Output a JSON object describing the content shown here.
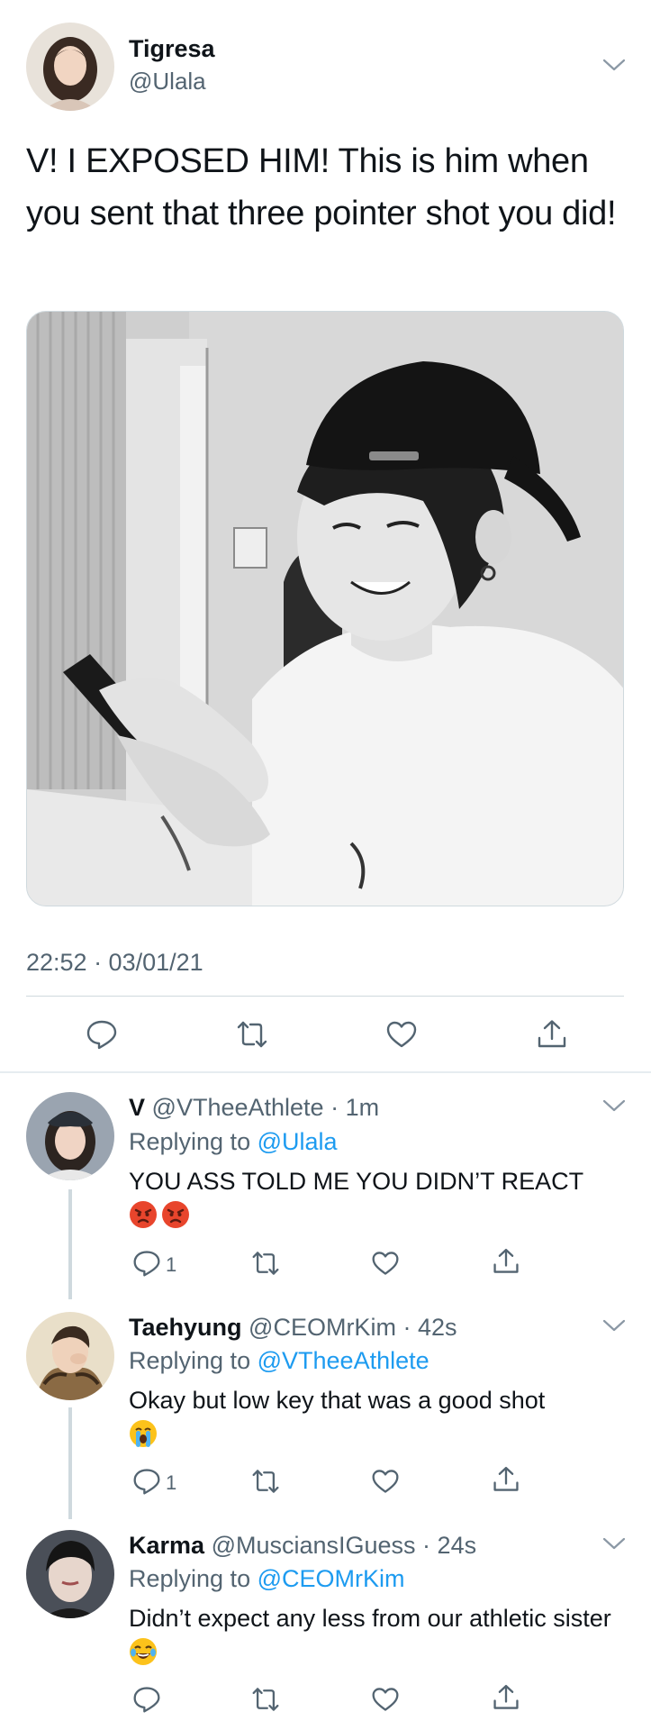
{
  "main_tweet": {
    "author_name": "Tigresa",
    "author_handle": "@Ulala",
    "text": "V! I EXPOSED HIM! This is him when you sent that three pointer shot you did!",
    "timestamp": "22:52 · 03/01/21",
    "actions": [
      "reply-icon",
      "retweet-icon",
      "like-icon",
      "share-icon"
    ]
  },
  "replies": [
    {
      "name": "V",
      "handle": "@VTheeAthlete",
      "time": "1m",
      "replying_label": "Replying to",
      "replying_to": "@Ulala",
      "text": "YOU ASS TOLD ME YOU DIDN’T REACT",
      "emojis": [
        "angry-face-emoji",
        "angry-face-emoji"
      ],
      "reply_count": "1"
    },
    {
      "name": "Taehyung",
      "handle": "@CEOMrKim",
      "time": "42s",
      "replying_label": "Replying to",
      "replying_to": "@VTheeAthlete",
      "text": "Okay but low key that was a good shot",
      "emojis": [
        "crying-face-emoji"
      ],
      "reply_count": "1"
    },
    {
      "name": "Karma",
      "handle": "@MusciansIGuess",
      "time": "24s",
      "replying_label": "Replying to",
      "replying_to": "@CEOMrKim",
      "text": "Didn’t expect any less from our athletic sister",
      "emojis": [
        "tears-of-joy-emoji"
      ],
      "reply_count": ""
    }
  ],
  "colors": {
    "link": "#1d9bf0",
    "secondary_text": "#536471",
    "divider": "#cfd9de"
  }
}
